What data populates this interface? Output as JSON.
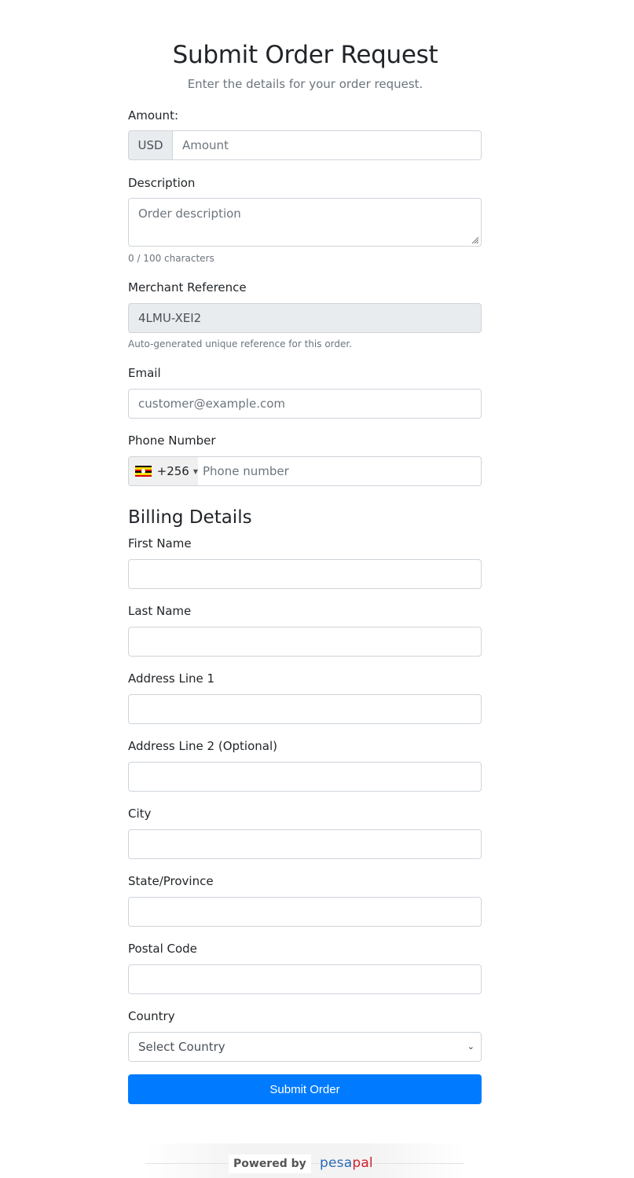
{
  "header": {
    "title": "Submit Order Request",
    "subtitle": "Enter the details for your order request."
  },
  "amount": {
    "label": "Amount:",
    "currency": "USD",
    "placeholder": "Amount",
    "value": ""
  },
  "description": {
    "label": "Description",
    "placeholder": "Order description",
    "value": "",
    "counter": "0 / 100 characters"
  },
  "merchant_reference": {
    "label": "Merchant Reference",
    "value": "4LMU-XEI2",
    "help": "Auto-generated unique reference for this order."
  },
  "email": {
    "label": "Email",
    "placeholder": "customer@example.com",
    "value": ""
  },
  "phone": {
    "label": "Phone Number",
    "country_flag": "uganda-flag",
    "dial_code": "+256",
    "placeholder": "Phone number",
    "value": ""
  },
  "billing": {
    "title": "Billing Details",
    "fields": [
      {
        "label": "First Name",
        "value": ""
      },
      {
        "label": "Last Name",
        "value": ""
      },
      {
        "label": "Address Line 1",
        "value": ""
      },
      {
        "label": "Address Line 2 (Optional)",
        "value": ""
      },
      {
        "label": "City",
        "value": ""
      },
      {
        "label": "State/Province",
        "value": ""
      },
      {
        "label": "Postal Code",
        "value": ""
      }
    ],
    "country": {
      "label": "Country",
      "selected": "Select Country"
    }
  },
  "submit": {
    "label": "Submit Order",
    "color": "#007bff"
  },
  "footer": {
    "powered_by": "Powered by",
    "brand_part1": "pesa",
    "brand_part2": "pal",
    "brand_color1": "#2a6ab3",
    "brand_color2": "#d0202e"
  }
}
